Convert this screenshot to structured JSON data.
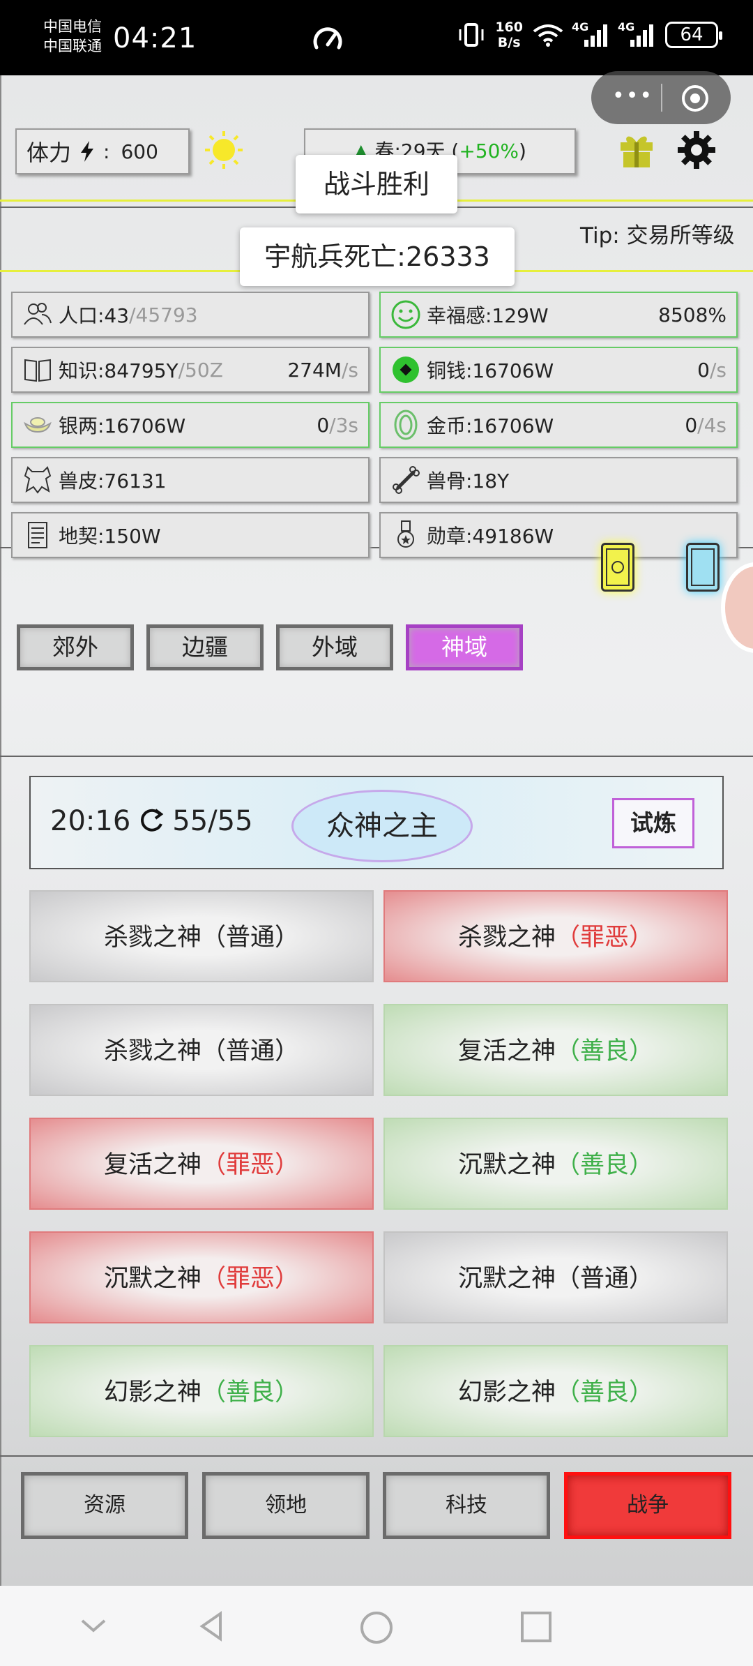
{
  "status_bar": {
    "carrier1": "中国电信",
    "carrier2": "中国联通",
    "time": "04:21",
    "net_speed_value": "160",
    "net_speed_unit": "B/s",
    "signal1": "4G",
    "signal2": "4G",
    "battery": "64"
  },
  "top_bar": {
    "stamina_label": "体力",
    "stamina_sep": ":",
    "stamina_value": "600",
    "season_text": "春:29天 (",
    "season_bonus": "+50%",
    "season_end": ")",
    "tip": "Tip: 交易所等级"
  },
  "toasts": {
    "battle_result": "战斗胜利",
    "casualty": "宇航兵死亡:26333"
  },
  "resources": [
    {
      "label": "人口:43",
      "muted": "/45793",
      "rate": "",
      "unit": ""
    },
    {
      "label": "幸福感:129W",
      "muted": "",
      "rate": "8508%",
      "unit": ""
    },
    {
      "label": "知识:84795Y",
      "muted": "/50Z",
      "rate": "274M",
      "unit": "/s"
    },
    {
      "label": "铜钱:16706W",
      "muted": "",
      "rate": "0",
      "unit": "/s"
    },
    {
      "label": "银两:16706W",
      "muted": "",
      "rate": "0",
      "unit": "/3s"
    },
    {
      "label": "金币:16706W",
      "muted": "",
      "rate": "0",
      "unit": "/4s"
    },
    {
      "label": "兽皮:76131",
      "muted": "",
      "rate": "",
      "unit": ""
    },
    {
      "label": "兽骨:18Y",
      "muted": "",
      "rate": "",
      "unit": ""
    },
    {
      "label": "地契:150W",
      "muted": "",
      "rate": "",
      "unit": ""
    },
    {
      "label": "勋章:49186W",
      "muted": "",
      "rate": "",
      "unit": ""
    }
  ],
  "region_tabs": [
    "郊外",
    "边疆",
    "外域",
    "神域"
  ],
  "active_region": "神域",
  "boss_header": {
    "time": "20:16",
    "count": "55/55",
    "name": "众神之主",
    "trial_button": "试炼"
  },
  "gods": [
    {
      "name": "杀戮之神",
      "quality": "（普通）",
      "type": "normal"
    },
    {
      "name": "杀戮之神",
      "quality": "（罪恶）",
      "type": "evil"
    },
    {
      "name": "杀戮之神",
      "quality": "（普通）",
      "type": "normal"
    },
    {
      "name": "复活之神",
      "quality": "（善良）",
      "type": "good"
    },
    {
      "name": "复活之神",
      "quality": "（罪恶）",
      "type": "evil"
    },
    {
      "name": "沉默之神",
      "quality": "（善良）",
      "type": "good"
    },
    {
      "name": "沉默之神",
      "quality": "（罪恶）",
      "type": "evil"
    },
    {
      "name": "沉默之神",
      "quality": "（普通）",
      "type": "normal"
    },
    {
      "name": "幻影之神",
      "quality": "（善良）",
      "type": "good"
    },
    {
      "name": "幻影之神",
      "quality": "（善良）",
      "type": "good"
    }
  ],
  "bottom_nav": [
    "资源",
    "领地",
    "科技",
    "战争"
  ],
  "active_nav": "战争",
  "colors": {
    "evil": "#e03c3c",
    "good": "#3fb04a",
    "active_tab": "#d56ae6",
    "active_nav": "#f03a3a",
    "tip_line": "#e6ef3c"
  }
}
